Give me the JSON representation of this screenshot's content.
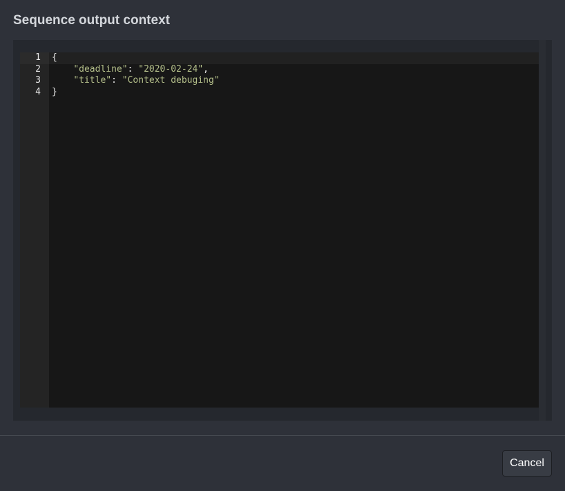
{
  "dialog": {
    "title": "Sequence output context"
  },
  "editor": {
    "line_numbers": [
      "1",
      "2",
      "3",
      "4"
    ],
    "lines": [
      {
        "open": "{"
      },
      {
        "indent": "    ",
        "key": "\"deadline\"",
        "sep": ": ",
        "value": "\"2020-02-24\"",
        "trail": ","
      },
      {
        "indent": "    ",
        "key": "\"title\"",
        "sep": ": ",
        "value": "\"Context debuging\"",
        "trail": ""
      },
      {
        "close": "}"
      }
    ]
  },
  "footer": {
    "cancel_label": "Cancel"
  },
  "colors": {
    "background": "#2e3139",
    "editor_background": "#171717",
    "gutter_background": "#242424",
    "string_color": "#b4bf8a",
    "button_background": "#383c44"
  }
}
